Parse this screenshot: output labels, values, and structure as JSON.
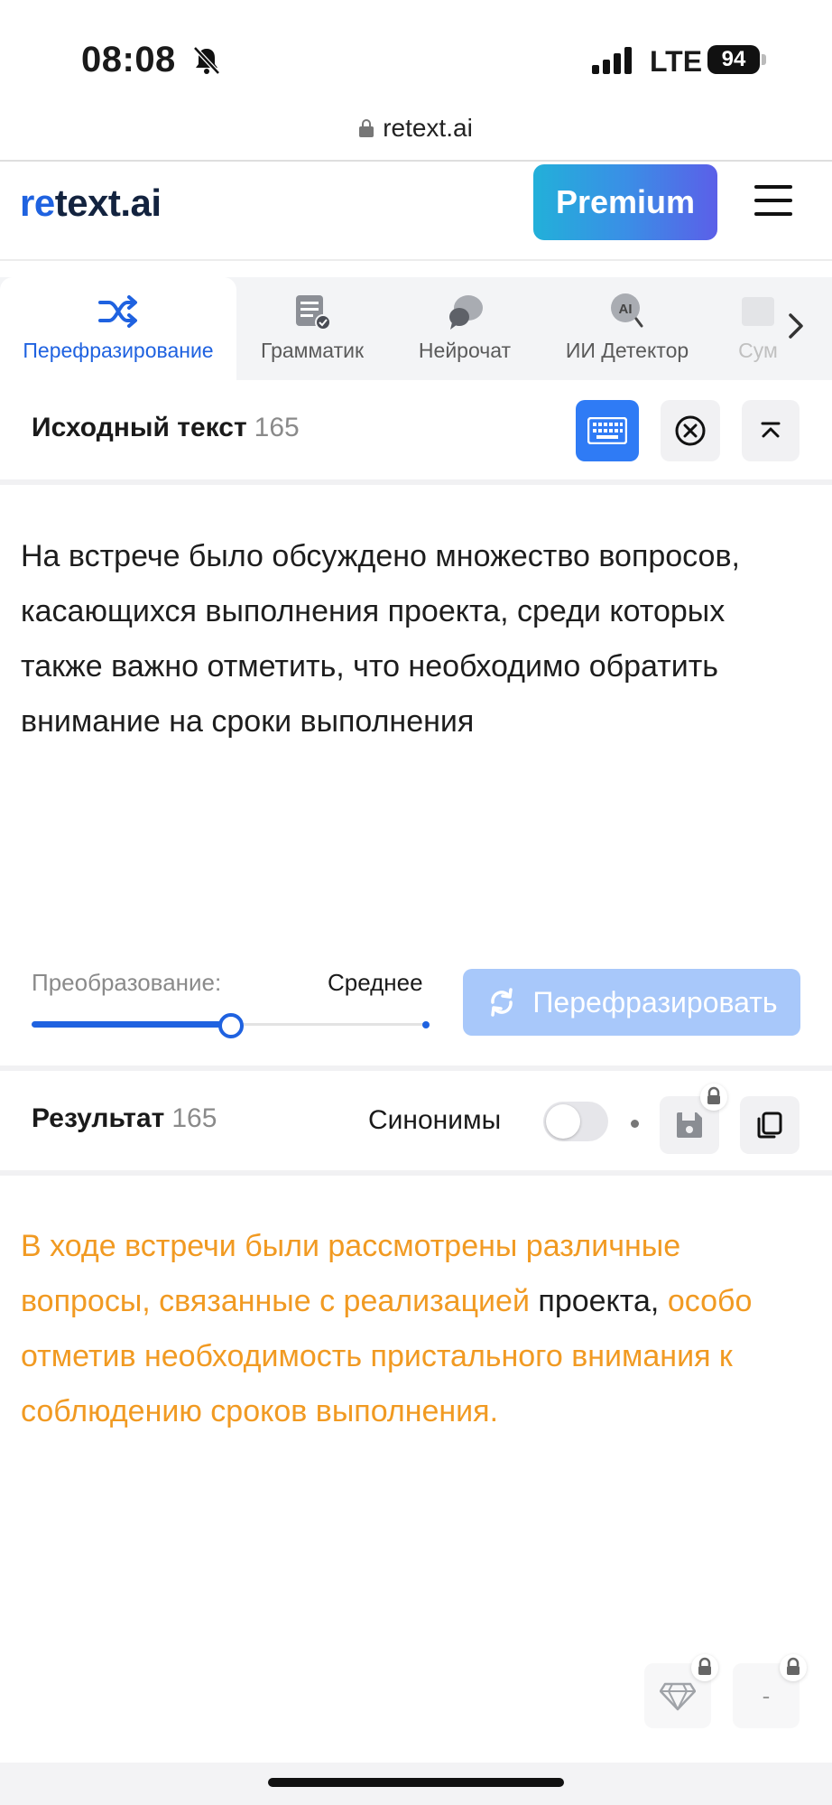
{
  "status_bar": {
    "time": "08:08",
    "network": "LTE",
    "battery": "94"
  },
  "browser": {
    "url": "retext.ai"
  },
  "header": {
    "logo_accent": "re",
    "logo_rest": "text.ai",
    "premium_label": "Premium"
  },
  "tabs": [
    {
      "label": "Перефразирование",
      "icon": "shuffle-icon",
      "active": true
    },
    {
      "label": "Грамматик",
      "icon": "grammar-doc-icon"
    },
    {
      "label": "Нейрочат",
      "icon": "chat-bubbles-icon"
    },
    {
      "label": "ИИ Детектор",
      "icon": "ai-detector-icon"
    },
    {
      "label": "Сум",
      "icon": "summary-icon"
    }
  ],
  "source": {
    "title": "Исходный текст",
    "count": "165",
    "text": "На встрече было обсуждено множество вопросов, касающихся выполнения проекта, среди которых также важно отметить, что необходимо обратить внимание на сроки выполнения"
  },
  "controls": {
    "transform_label": "Преобразование:",
    "transform_value": "Среднее",
    "transform_level_fraction": 0.5,
    "rephrase_label": "Перефразировать"
  },
  "result": {
    "title": "Результат",
    "count": "165",
    "synonyms_label": "Синонимы",
    "segments": [
      {
        "text": "В ходе встречи были рассмотрены различные вопросы, связанные с реализацией",
        "changed": true
      },
      {
        "text": " проекта, ",
        "changed": false
      },
      {
        "text": "особо отметив необходимость пристального внимания к соблюдению сроков выполнения.",
        "changed": true
      }
    ]
  },
  "bottom": {
    "second_button_label": "-"
  },
  "colors": {
    "accent": "#1f62e0",
    "changed_text": "#f19a22",
    "premium_start": "#22b0d9",
    "premium_end": "#5b5fe8"
  }
}
